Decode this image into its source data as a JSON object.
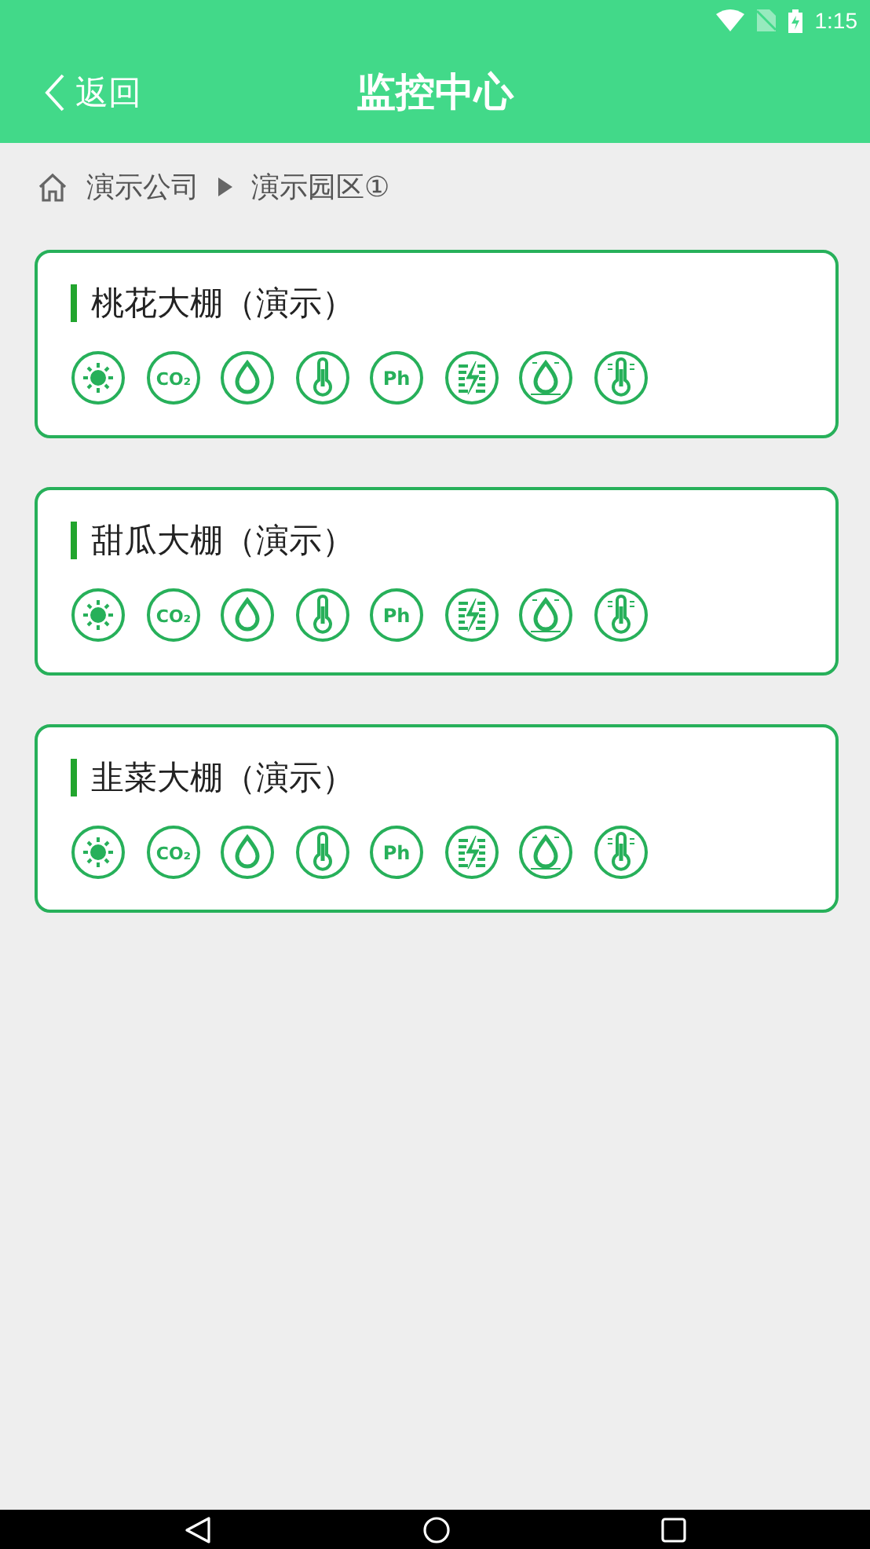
{
  "status_bar": {
    "time": "1:15"
  },
  "header": {
    "back": "返回",
    "title": "监控中心"
  },
  "breadcrumb": [
    {
      "label": "演示公司"
    },
    {
      "label": "演示园区①"
    }
  ],
  "greenhouses": [
    {
      "name": "桃花大棚（演示）",
      "sensors": [
        {
          "kind": "light"
        },
        {
          "kind": "co2",
          "label": "CO₂"
        },
        {
          "kind": "humidity"
        },
        {
          "kind": "temperature"
        },
        {
          "kind": "ph",
          "label": "Ph"
        },
        {
          "kind": "ec"
        },
        {
          "kind": "soil-humidity"
        },
        {
          "kind": "soil-temperature"
        }
      ]
    },
    {
      "name": "甜瓜大棚（演示）",
      "sensors": [
        {
          "kind": "light"
        },
        {
          "kind": "co2",
          "label": "CO₂"
        },
        {
          "kind": "humidity"
        },
        {
          "kind": "temperature"
        },
        {
          "kind": "ph",
          "label": "Ph"
        },
        {
          "kind": "ec"
        },
        {
          "kind": "soil-humidity"
        },
        {
          "kind": "soil-temperature"
        }
      ]
    },
    {
      "name": "韭菜大棚（演示）",
      "sensors": [
        {
          "kind": "light"
        },
        {
          "kind": "co2",
          "label": "CO₂"
        },
        {
          "kind": "humidity"
        },
        {
          "kind": "temperature"
        },
        {
          "kind": "ph",
          "label": "Ph"
        },
        {
          "kind": "ec"
        },
        {
          "kind": "soil-humidity"
        },
        {
          "kind": "soil-temperature"
        }
      ]
    }
  ]
}
